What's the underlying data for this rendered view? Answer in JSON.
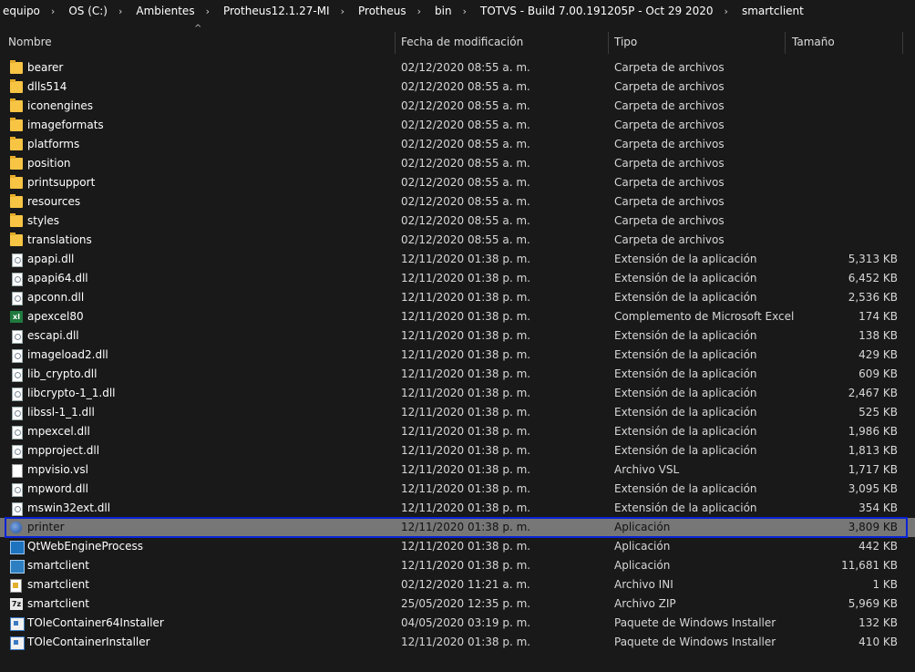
{
  "breadcrumb": [
    "equipo",
    "OS (C:)",
    "Ambientes",
    "Protheus12.1.27-MI",
    "Protheus",
    "bin",
    "TOTVS - Build 7.00.191205P - Oct 29 2020",
    "smartclient"
  ],
  "columns": {
    "name": "Nombre",
    "date": "Fecha de modificación",
    "type": "Tipo",
    "size": "Tamaño"
  },
  "rows": [
    {
      "name": "bearer",
      "date": "02/12/2020 08:55 a. m.",
      "type": "Carpeta de archivos",
      "size": "",
      "icon": "folder-icon"
    },
    {
      "name": "dlls514",
      "date": "02/12/2020 08:55 a. m.",
      "type": "Carpeta de archivos",
      "size": "",
      "icon": "folder-icon"
    },
    {
      "name": "iconengines",
      "date": "02/12/2020 08:55 a. m.",
      "type": "Carpeta de archivos",
      "size": "",
      "icon": "folder-icon"
    },
    {
      "name": "imageformats",
      "date": "02/12/2020 08:55 a. m.",
      "type": "Carpeta de archivos",
      "size": "",
      "icon": "folder-icon"
    },
    {
      "name": "platforms",
      "date": "02/12/2020 08:55 a. m.",
      "type": "Carpeta de archivos",
      "size": "",
      "icon": "folder-icon"
    },
    {
      "name": "position",
      "date": "02/12/2020 08:55 a. m.",
      "type": "Carpeta de archivos",
      "size": "",
      "icon": "folder-icon"
    },
    {
      "name": "printsupport",
      "date": "02/12/2020 08:55 a. m.",
      "type": "Carpeta de archivos",
      "size": "",
      "icon": "folder-icon"
    },
    {
      "name": "resources",
      "date": "02/12/2020 08:55 a. m.",
      "type": "Carpeta de archivos",
      "size": "",
      "icon": "folder-icon"
    },
    {
      "name": "styles",
      "date": "02/12/2020 08:55 a. m.",
      "type": "Carpeta de archivos",
      "size": "",
      "icon": "folder-icon"
    },
    {
      "name": "translations",
      "date": "02/12/2020 08:55 a. m.",
      "type": "Carpeta de archivos",
      "size": "",
      "icon": "folder-icon"
    },
    {
      "name": "apapi.dll",
      "date": "12/11/2020 01:38 p. m.",
      "type": "Extensión de la aplicación",
      "size": "5,313 KB",
      "icon": "dll-icon"
    },
    {
      "name": "apapi64.dll",
      "date": "12/11/2020 01:38 p. m.",
      "type": "Extensión de la aplicación",
      "size": "6,452 KB",
      "icon": "dll-icon"
    },
    {
      "name": "apconn.dll",
      "date": "12/11/2020 01:38 p. m.",
      "type": "Extensión de la aplicación",
      "size": "2,536 KB",
      "icon": "dll-icon"
    },
    {
      "name": "apexcel80",
      "date": "12/11/2020 01:38 p. m.",
      "type": "Complemento de Microsoft Excel",
      "size": "174 KB",
      "icon": "excel-addin-icon"
    },
    {
      "name": "escapi.dll",
      "date": "12/11/2020 01:38 p. m.",
      "type": "Extensión de la aplicación",
      "size": "138 KB",
      "icon": "dll-icon"
    },
    {
      "name": "imageload2.dll",
      "date": "12/11/2020 01:38 p. m.",
      "type": "Extensión de la aplicación",
      "size": "429 KB",
      "icon": "dll-icon"
    },
    {
      "name": "lib_crypto.dll",
      "date": "12/11/2020 01:38 p. m.",
      "type": "Extensión de la aplicación",
      "size": "609 KB",
      "icon": "dll-icon"
    },
    {
      "name": "libcrypto-1_1.dll",
      "date": "12/11/2020 01:38 p. m.",
      "type": "Extensión de la aplicación",
      "size": "2,467 KB",
      "icon": "dll-icon"
    },
    {
      "name": "libssl-1_1.dll",
      "date": "12/11/2020 01:38 p. m.",
      "type": "Extensión de la aplicación",
      "size": "525 KB",
      "icon": "dll-icon"
    },
    {
      "name": "mpexcel.dll",
      "date": "12/11/2020 01:38 p. m.",
      "type": "Extensión de la aplicación",
      "size": "1,986 KB",
      "icon": "dll-icon"
    },
    {
      "name": "mpproject.dll",
      "date": "12/11/2020 01:38 p. m.",
      "type": "Extensión de la aplicación",
      "size": "1,813 KB",
      "icon": "dll-icon"
    },
    {
      "name": "mpvisio.vsl",
      "date": "12/11/2020 01:38 p. m.",
      "type": "Archivo VSL",
      "size": "1,717 KB",
      "icon": "file-icon"
    },
    {
      "name": "mpword.dll",
      "date": "12/11/2020 01:38 p. m.",
      "type": "Extensión de la aplicación",
      "size": "3,095 KB",
      "icon": "dll-icon"
    },
    {
      "name": "mswin32ext.dll",
      "date": "12/11/2020 01:38 p. m.",
      "type": "Extensión de la aplicación",
      "size": "354 KB",
      "icon": "dll-icon"
    },
    {
      "name": "printer",
      "date": "12/11/2020 01:38 p. m.",
      "type": "Aplicación",
      "size": "3,809 KB",
      "icon": "globe-app-icon",
      "selected": true
    },
    {
      "name": "QtWebEngineProcess",
      "date": "12/11/2020 01:38 p. m.",
      "type": "Aplicación",
      "size": "442 KB",
      "icon": "qt-app-icon"
    },
    {
      "name": "smartclient",
      "date": "12/11/2020 01:38 p. m.",
      "type": "Aplicación",
      "size": "11,681 KB",
      "icon": "app-icon"
    },
    {
      "name": "smartclient",
      "date": "02/12/2020 11:21 a. m.",
      "type": "Archivo INI",
      "size": "1 KB",
      "icon": "ini-icon"
    },
    {
      "name": "smartclient",
      "date": "25/05/2020 12:35 p. m.",
      "type": "Archivo ZIP",
      "size": "5,969 KB",
      "icon": "zip-icon"
    },
    {
      "name": "TOleContainer64Installer",
      "date": "04/05/2020 03:19 p. m.",
      "type": "Paquete de Windows Installer",
      "size": "132 KB",
      "icon": "msi-icon"
    },
    {
      "name": "TOleContainerInstaller",
      "date": "12/11/2020 01:38 p. m.",
      "type": "Paquete de Windows Installer",
      "size": "410 KB",
      "icon": "msi-icon"
    }
  ],
  "colors": {
    "background": "#191919",
    "selected_row": "#777777",
    "selection_border": "#0a22d6"
  }
}
